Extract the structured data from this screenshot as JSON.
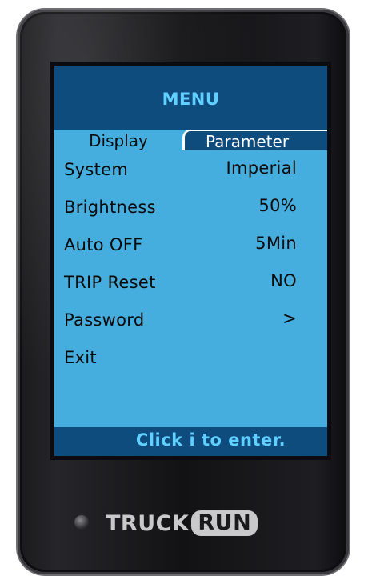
{
  "screen": {
    "title": "MENU",
    "tabs": [
      {
        "label": "Display",
        "active": true
      },
      {
        "label": "Parameter",
        "active": false
      }
    ],
    "items": [
      {
        "label": "System",
        "value": "Imperial"
      },
      {
        "label": "Brightness",
        "value": "50%"
      },
      {
        "label": "Auto OFF",
        "value": "5Min"
      },
      {
        "label": "TRIP Reset",
        "value": "NO"
      },
      {
        "label": "Password",
        "value": ">"
      },
      {
        "label": "Exit",
        "value": ""
      }
    ],
    "footer_hint": "Click i to enter."
  },
  "device": {
    "brand_part1": "TRUCK",
    "brand_part2": "RUN"
  },
  "colors": {
    "screen_bg": "#46aede",
    "header_bg": "#0f4c7e",
    "accent_text": "#5fd0ff",
    "body_text": "#0a0a0a",
    "bezel": "#141416"
  }
}
